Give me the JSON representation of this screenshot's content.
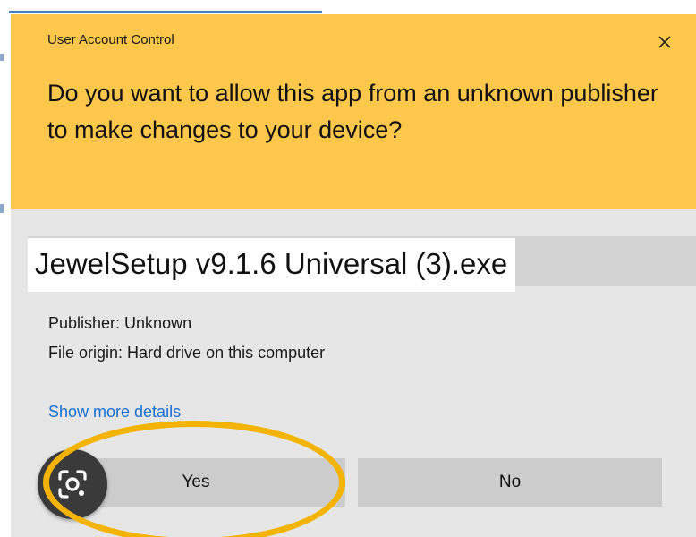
{
  "dialog": {
    "title": "User Account Control",
    "question": "Do you want to allow this app from an unknown publisher to make changes to your device?",
    "app_name": "JewelSetup v9.1.6 Universal (3).exe",
    "publisher": "Publisher: Unknown",
    "file_origin": "File origin: Hard drive on this computer",
    "details_link": "Show more details",
    "yes_label": "Yes",
    "no_label": "No",
    "close_icon": "close-icon"
  },
  "colors": {
    "header": "#fcc74a",
    "body": "#e6e6e6",
    "button": "#cccccc",
    "link": "#1a6fd0",
    "annotation_ring": "#f5b301"
  },
  "overlay": {
    "lens_icon": "google-lens-icon"
  }
}
